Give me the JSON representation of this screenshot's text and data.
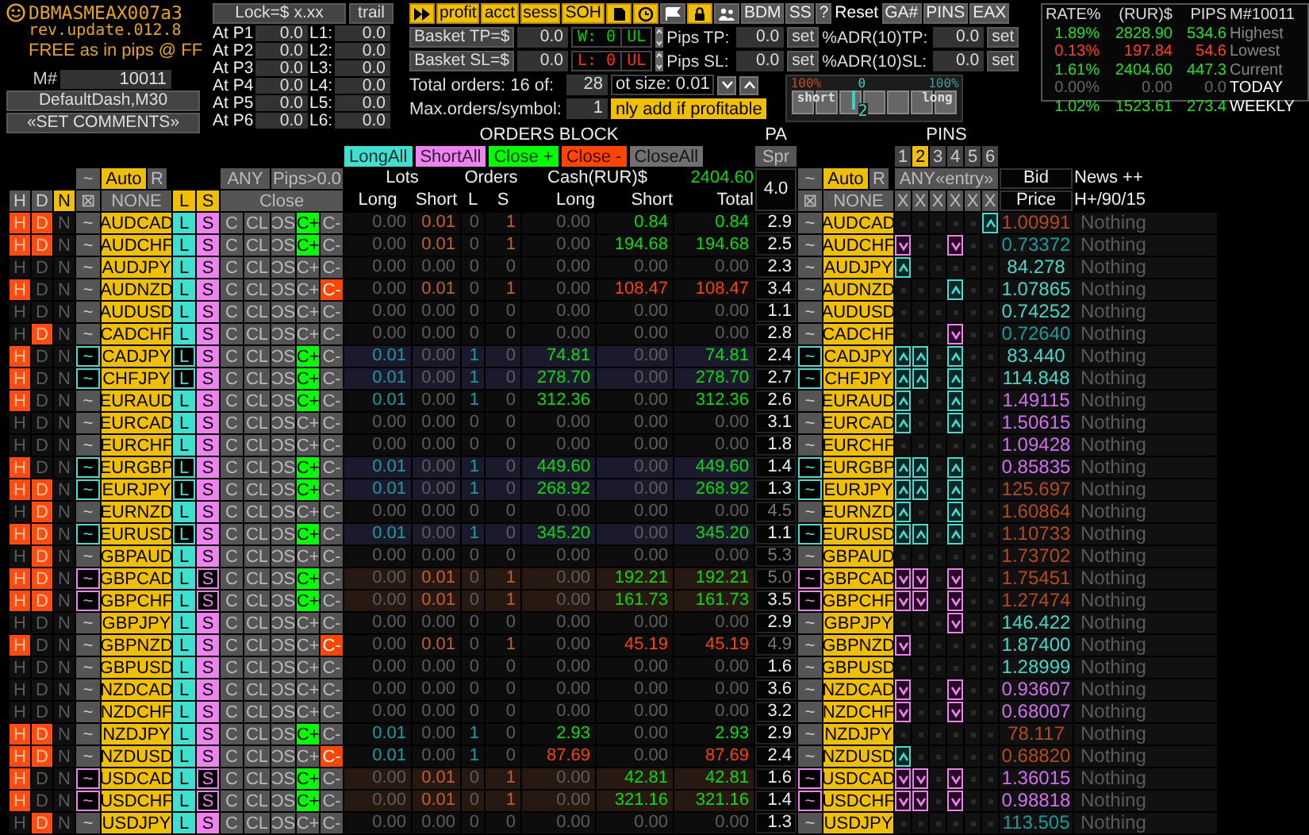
{
  "header": {
    "title": "DBMASMEAX007a3",
    "version": "rev.update.012.8",
    "tagline": "FREE as in pips @ FF",
    "magic_label": "M#",
    "magic": "10011",
    "buttons": [
      "DefaultDash,M30",
      "«SET COMMENTS»"
    ]
  },
  "lock": {
    "title": "Lock=$ x.xx",
    "trail": "trail",
    "rows": [
      {
        "p_label": "At P1",
        "p_value": "0.0",
        "l_label": "L1:",
        "l_value": "0.0"
      },
      {
        "p_label": "At P2",
        "p_value": "0.0",
        "l_label": "L2:",
        "l_value": "0.0"
      },
      {
        "p_label": "At P3",
        "p_value": "0.0",
        "l_label": "L3:",
        "l_value": "0.0"
      },
      {
        "p_label": "At P4",
        "p_value": "0.0",
        "l_label": "L4:",
        "l_value": "0.0"
      },
      {
        "p_label": "At P5",
        "p_value": "0.0",
        "l_label": "L5:",
        "l_value": "0.0"
      },
      {
        "p_label": "At P6",
        "p_value": "0.0",
        "l_label": "L6:",
        "l_value": "0.0"
      }
    ]
  },
  "toolbar": [
    {
      "kind": "icon",
      "active": true
    },
    {
      "kind": "text",
      "label": "profit",
      "active": true
    },
    {
      "kind": "text",
      "label": "acct",
      "active": true
    },
    {
      "kind": "text",
      "label": "sess",
      "active": true
    },
    {
      "kind": "text",
      "label": "SOH",
      "active": true
    },
    {
      "kind": "icon",
      "active": true
    },
    {
      "kind": "icon",
      "active": true
    },
    {
      "kind": "icon",
      "active": false
    },
    {
      "kind": "icon",
      "active": true
    },
    {
      "kind": "icon",
      "active": false
    },
    {
      "kind": "text",
      "label": "BDM",
      "active": false
    },
    {
      "kind": "text",
      "label": "SS",
      "active": false
    },
    {
      "kind": "text",
      "label": "?",
      "active": false
    },
    {
      "kind": "plain",
      "label": "Reset"
    },
    {
      "kind": "text",
      "label": "GA#",
      "active": false
    },
    {
      "kind": "text",
      "label": "PINS",
      "active": false
    },
    {
      "kind": "text",
      "label": "EAX",
      "active": false
    }
  ],
  "basket": [
    {
      "label": "Basket TP=$",
      "value": "0.0",
      "counter": "W: 0",
      "loss": false,
      "ul": "UL",
      "pips_label": "Pips TP:",
      "pips_value": "0.0",
      "pips_set": "set",
      "adr_label": "%ADR(10)TP:",
      "adr_value": "0.0",
      "adr_set": "set"
    },
    {
      "label": "Basket SL=$",
      "value": "0.0",
      "counter": "L: 0",
      "loss": true,
      "ul": "UL",
      "pips_label": "Pips SL:",
      "pips_value": "0.0",
      "pips_set": "set",
      "adr_label": "%ADR(10)SL:",
      "adr_value": "0.0",
      "adr_set": "set"
    }
  ],
  "orders": {
    "total_label": "Total orders: 16 of:",
    "total_value": "28",
    "lot_label": "ot size: 0.01",
    "max_label": "Max.orders/symbol:",
    "max_value": "1",
    "only_add": "nly add if profitable",
    "only_add_on": true
  },
  "balance": {
    "left_pct": "100%",
    "center": "0",
    "right_pct": "100%",
    "short": "short",
    "long": "long",
    "value": "2",
    "level": 0.36
  },
  "stats": {
    "columns": [
      "RATE%",
      "(RUR)$",
      "PIPS",
      "M#10011"
    ],
    "rows": [
      {
        "rate": "1.89%",
        "cash": "2828.90",
        "pips": "534.6",
        "label": "Highest",
        "loss": false,
        "zero": false,
        "label_bright": false
      },
      {
        "rate": "0.13%",
        "cash": "197.84",
        "pips": "54.6",
        "label": "Lowest",
        "loss": true,
        "zero": false,
        "label_bright": false
      },
      {
        "rate": "1.61%",
        "cash": "2404.60",
        "pips": "447.3",
        "label": "Current",
        "loss": false,
        "zero": false,
        "label_bright": false
      },
      {
        "rate": "0.00%",
        "cash": "0.00",
        "pips": "0.0",
        "label": "TODAY",
        "loss": false,
        "zero": true,
        "label_bright": true
      },
      {
        "rate": "1.02%",
        "cash": "1523.61",
        "pips": "273.4",
        "label": "WEEKLY",
        "loss": false,
        "zero": false,
        "label_bright": true
      }
    ]
  },
  "grid_header": {
    "left": {
      "tilde": "~",
      "auto": "Auto",
      "auto_on": true,
      "r": "R",
      "any": "ANY",
      "pips": "Pips>0.0",
      "h": "H",
      "d": "D",
      "n": "N",
      "n_on": true,
      "box": "⊠",
      "none": "NONE",
      "l": "L",
      "s": "S",
      "close": "Close"
    },
    "orders_block": {
      "title": "ORDERS BLOCK",
      "actions": [
        {
          "label": "LongAll",
          "color": "#40e0d0"
        },
        {
          "label": "ShortAll",
          "color": "#ee82ee"
        },
        {
          "label": "Close +",
          "color": "#00ff00"
        },
        {
          "label": "Close -",
          "color": "#ff4500"
        },
        {
          "label": "CloseAll",
          "color": "#707070"
        }
      ],
      "lots": "Lots",
      "orders": "Orders",
      "cash": "Cash(RUR)$",
      "total_cash": "2404.60",
      "sub": [
        "Long",
        "Short",
        "L",
        "S",
        "Long",
        "Short",
        "Total"
      ]
    },
    "pa": {
      "title": "PA",
      "spr": "Spr",
      "value": "4.0"
    },
    "right": {
      "tilde": "~",
      "auto": "Auto",
      "auto_on": true,
      "r": "R",
      "box": "⊠",
      "none": "NONE"
    },
    "pins": {
      "title": "PINS",
      "tabs": [
        {
          "label": "1",
          "selected": false
        },
        {
          "label": "2",
          "selected": true
        },
        {
          "label": "3",
          "selected": false
        },
        {
          "label": "4",
          "selected": false
        },
        {
          "label": "5",
          "selected": false
        },
        {
          "label": "6",
          "selected": false
        }
      ],
      "any": "ANY«entry»",
      "clear": [
        "X",
        "X",
        "X",
        "X",
        "X",
        "X"
      ]
    },
    "bid": {
      "title": "Bid",
      "sub": "Price"
    },
    "news": {
      "title": "News ++",
      "sub": "H+/90/15"
    }
  },
  "rows": [
    {
      "labels": [
        "H",
        "D",
        "N",
        "~",
        "L",
        "S",
        "C",
        "CL",
        "ƆS",
        "C+",
        "C-",
        "~"
      ],
      "h": true,
      "d": true,
      "n": false,
      "symbol": "AUDCAD",
      "long": false,
      "short": true,
      "focus": false,
      "cplus": true,
      "cminus": false,
      "lots_long": "0.00",
      "lots_short": "0.01",
      "orders_long": "0",
      "orders_short": "1",
      "cash_long": "0.00",
      "cash_short": "0.84",
      "cash_total": "0.84",
      "loss": false,
      "spread": "2.9",
      "spread_wide": false,
      "pin_symbol": "AUDCAD",
      "pins": [
        {
          "up": false,
          "down": false
        },
        {
          "up": false,
          "down": false
        },
        {
          "up": false,
          "down": false
        },
        {
          "up": false,
          "down": false
        },
        {
          "up": false,
          "down": false
        },
        {
          "up": true,
          "down": false
        }
      ],
      "bid": "1.00991",
      "color": "#b44a1e",
      "news": "Nothing"
    },
    {
      "labels": [
        "H",
        "D",
        "N",
        "~",
        "L",
        "S",
        "C",
        "CL",
        "ƆS",
        "C+",
        "C-",
        "~"
      ],
      "h": true,
      "d": true,
      "n": false,
      "symbol": "AUDCHF",
      "long": false,
      "short": true,
      "focus": false,
      "cplus": true,
      "cminus": false,
      "lots_long": "0.00",
      "lots_short": "0.01",
      "orders_long": "0",
      "orders_short": "1",
      "cash_long": "0.00",
      "cash_short": "194.68",
      "cash_total": "194.68",
      "loss": false,
      "spread": "2.5",
      "spread_wide": false,
      "pin_symbol": "AUDCHF",
      "pins": [
        {
          "up": false,
          "down": true
        },
        {
          "up": false,
          "down": false
        },
        {
          "up": false,
          "down": false
        },
        {
          "up": false,
          "down": true
        },
        {
          "up": false,
          "down": false
        },
        {
          "up": false,
          "down": false
        }
      ],
      "bid": "0.73372",
      "color": "#1a9a9a",
      "news": "Nothing"
    },
    {
      "labels": [
        "H",
        "D",
        "N",
        "~",
        "L",
        "S",
        "C",
        "CL",
        "ƆS",
        "C+",
        "C-",
        "~"
      ],
      "h": false,
      "d": false,
      "n": false,
      "symbol": "AUDJPY",
      "long": false,
      "short": false,
      "focus": false,
      "cplus": false,
      "cminus": false,
      "lots_long": "0.00",
      "lots_short": "0.00",
      "orders_long": "0",
      "orders_short": "0",
      "cash_long": "0.00",
      "cash_short": "0.00",
      "cash_total": "0.00",
      "loss": false,
      "spread": "2.3",
      "spread_wide": false,
      "pin_symbol": "AUDJPY",
      "pins": [
        {
          "up": true,
          "down": false
        },
        {
          "up": false,
          "down": false
        },
        {
          "up": false,
          "down": false
        },
        {
          "up": false,
          "down": false
        },
        {
          "up": false,
          "down": false
        },
        {
          "up": false,
          "down": false
        }
      ],
      "bid": "84.278",
      "color": "#40d8c8",
      "news": "Nothing"
    },
    {
      "labels": [
        "H",
        "D",
        "N",
        "~",
        "L",
        "S",
        "C",
        "CL",
        "ƆS",
        "C+",
        "C-",
        "~"
      ],
      "h": true,
      "d": false,
      "n": false,
      "symbol": "AUDNZD",
      "long": false,
      "short": true,
      "focus": false,
      "cplus": false,
      "cminus": true,
      "lots_long": "0.00",
      "lots_short": "0.01",
      "orders_long": "0",
      "orders_short": "1",
      "cash_long": "0.00",
      "cash_short": "108.47",
      "cash_total": "108.47",
      "loss": true,
      "spread": "3.4",
      "spread_wide": false,
      "pin_symbol": "AUDNZD",
      "pins": [
        {
          "up": false,
          "down": false
        },
        {
          "up": false,
          "down": false
        },
        {
          "up": false,
          "down": false
        },
        {
          "up": true,
          "down": false
        },
        {
          "up": false,
          "down": false
        },
        {
          "up": false,
          "down": false
        }
      ],
      "bid": "1.07865",
      "color": "#40d8c8",
      "news": "Nothing"
    },
    {
      "labels": [
        "H",
        "D",
        "N",
        "~",
        "L",
        "S",
        "C",
        "CL",
        "ƆS",
        "C+",
        "C-",
        "~"
      ],
      "h": false,
      "d": false,
      "n": false,
      "symbol": "AUDUSD",
      "long": false,
      "short": false,
      "focus": false,
      "cplus": false,
      "cminus": false,
      "lots_long": "0.00",
      "lots_short": "0.00",
      "orders_long": "0",
      "orders_short": "0",
      "cash_long": "0.00",
      "cash_short": "0.00",
      "cash_total": "0.00",
      "loss": false,
      "spread": "1.1",
      "spread_wide": false,
      "pin_symbol": "AUDUSD",
      "pins": [
        {
          "up": false,
          "down": false
        },
        {
          "up": false,
          "down": false
        },
        {
          "up": false,
          "down": false
        },
        {
          "up": false,
          "down": false
        },
        {
          "up": false,
          "down": false
        },
        {
          "up": false,
          "down": false
        }
      ],
      "bid": "0.74252",
      "color": "#40d8c8",
      "news": "Nothing"
    },
    {
      "labels": [
        "H",
        "D",
        "N",
        "~",
        "L",
        "S",
        "C",
        "CL",
        "ƆS",
        "C+",
        "C-",
        "~"
      ],
      "h": false,
      "d": true,
      "n": false,
      "symbol": "CADCHF",
      "long": false,
      "short": false,
      "focus": false,
      "cplus": false,
      "cminus": false,
      "lots_long": "0.00",
      "lots_short": "0.00",
      "orders_long": "0",
      "orders_short": "0",
      "cash_long": "0.00",
      "cash_short": "0.00",
      "cash_total": "0.00",
      "loss": false,
      "spread": "2.8",
      "spread_wide": false,
      "pin_symbol": "CADCHF",
      "pins": [
        {
          "up": false,
          "down": false
        },
        {
          "up": false,
          "down": false
        },
        {
          "up": false,
          "down": false
        },
        {
          "up": false,
          "down": true
        },
        {
          "up": false,
          "down": false
        },
        {
          "up": false,
          "down": false
        }
      ],
      "bid": "0.72640",
      "color": "#1a9a9a",
      "news": "Nothing"
    },
    {
      "labels": [
        "H",
        "D",
        "N",
        "~",
        "L",
        "S",
        "C",
        "CL",
        "ƆS",
        "C+",
        "C-",
        "~"
      ],
      "h": true,
      "d": false,
      "n": false,
      "symbol": "CADJPY",
      "long": true,
      "short": false,
      "focus": true,
      "cplus": true,
      "cminus": false,
      "lots_long": "0.01",
      "lots_short": "0.00",
      "orders_long": "1",
      "orders_short": "0",
      "cash_long": "74.81",
      "cash_short": "0.00",
      "cash_total": "74.81",
      "loss": false,
      "spread": "2.4",
      "spread_wide": false,
      "pin_symbol": "CADJPY",
      "pins": [
        {
          "up": true,
          "down": false
        },
        {
          "up": true,
          "down": false
        },
        {
          "up": false,
          "down": false
        },
        {
          "up": true,
          "down": false
        },
        {
          "up": false,
          "down": false
        },
        {
          "up": false,
          "down": false
        }
      ],
      "bid": "83.440",
      "color": "#40d8c8",
      "news": "Nothing"
    },
    {
      "labels": [
        "H",
        "D",
        "N",
        "~",
        "L",
        "S",
        "C",
        "CL",
        "ƆS",
        "C+",
        "C-",
        "~"
      ],
      "h": true,
      "d": false,
      "n": false,
      "symbol": "CHFJPY",
      "long": true,
      "short": false,
      "focus": true,
      "cplus": true,
      "cminus": false,
      "lots_long": "0.01",
      "lots_short": "0.00",
      "orders_long": "1",
      "orders_short": "0",
      "cash_long": "278.70",
      "cash_short": "0.00",
      "cash_total": "278.70",
      "loss": false,
      "spread": "2.7",
      "spread_wide": false,
      "pin_symbol": "CHFJPY",
      "pins": [
        {
          "up": true,
          "down": false
        },
        {
          "up": true,
          "down": false
        },
        {
          "up": false,
          "down": false
        },
        {
          "up": true,
          "down": false
        },
        {
          "up": false,
          "down": false
        },
        {
          "up": false,
          "down": false
        }
      ],
      "bid": "114.848",
      "color": "#40d8c8",
      "news": "Nothing"
    },
    {
      "labels": [
        "H",
        "D",
        "N",
        "~",
        "L",
        "S",
        "C",
        "CL",
        "ƆS",
        "C+",
        "C-",
        "~"
      ],
      "h": true,
      "d": false,
      "n": false,
      "symbol": "EURAUD",
      "long": true,
      "short": false,
      "focus": false,
      "cplus": true,
      "cminus": false,
      "lots_long": "0.01",
      "lots_short": "0.00",
      "orders_long": "1",
      "orders_short": "0",
      "cash_long": "312.36",
      "cash_short": "0.00",
      "cash_total": "312.36",
      "loss": false,
      "spread": "2.6",
      "spread_wide": false,
      "pin_symbol": "EURAUD",
      "pins": [
        {
          "up": true,
          "down": false
        },
        {
          "up": false,
          "down": false
        },
        {
          "up": false,
          "down": false
        },
        {
          "up": true,
          "down": false
        },
        {
          "up": false,
          "down": false
        },
        {
          "up": false,
          "down": false
        }
      ],
      "bid": "1.49115",
      "color": "#d070f0",
      "news": "Nothing"
    },
    {
      "labels": [
        "H",
        "D",
        "N",
        "~",
        "L",
        "S",
        "C",
        "CL",
        "ƆS",
        "C+",
        "C-",
        "~"
      ],
      "h": false,
      "d": false,
      "n": false,
      "symbol": "EURCAD",
      "long": false,
      "short": false,
      "focus": false,
      "cplus": false,
      "cminus": false,
      "lots_long": "0.00",
      "lots_short": "0.00",
      "orders_long": "0",
      "orders_short": "0",
      "cash_long": "0.00",
      "cash_short": "0.00",
      "cash_total": "0.00",
      "loss": false,
      "spread": "3.1",
      "spread_wide": false,
      "pin_symbol": "EURCAD",
      "pins": [
        {
          "up": true,
          "down": false
        },
        {
          "up": false,
          "down": false
        },
        {
          "up": false,
          "down": false
        },
        {
          "up": true,
          "down": false
        },
        {
          "up": false,
          "down": false
        },
        {
          "up": false,
          "down": false
        }
      ],
      "bid": "1.50615",
      "color": "#d070f0",
      "news": "Nothing"
    },
    {
      "labels": [
        "H",
        "D",
        "N",
        "~",
        "L",
        "S",
        "C",
        "CL",
        "ƆS",
        "C+",
        "C-",
        "~"
      ],
      "h": false,
      "d": false,
      "n": false,
      "symbol": "EURCHF",
      "long": false,
      "short": false,
      "focus": false,
      "cplus": false,
      "cminus": false,
      "lots_long": "0.00",
      "lots_short": "0.00",
      "orders_long": "0",
      "orders_short": "0",
      "cash_long": "0.00",
      "cash_short": "0.00",
      "cash_total": "0.00",
      "loss": false,
      "spread": "1.8",
      "spread_wide": false,
      "pin_symbol": "EURCHF",
      "pins": [
        {
          "up": false,
          "down": false
        },
        {
          "up": false,
          "down": false
        },
        {
          "up": false,
          "down": false
        },
        {
          "up": false,
          "down": false
        },
        {
          "up": false,
          "down": false
        },
        {
          "up": false,
          "down": false
        }
      ],
      "bid": "1.09428",
      "color": "#d070f0",
      "news": "Nothing"
    },
    {
      "labels": [
        "H",
        "D",
        "N",
        "~",
        "L",
        "S",
        "C",
        "CL",
        "ƆS",
        "C+",
        "C-",
        "~"
      ],
      "h": true,
      "d": false,
      "n": false,
      "symbol": "EURGBP",
      "long": true,
      "short": false,
      "focus": true,
      "cplus": true,
      "cminus": false,
      "lots_long": "0.01",
      "lots_short": "0.00",
      "orders_long": "1",
      "orders_short": "0",
      "cash_long": "449.60",
      "cash_short": "0.00",
      "cash_total": "449.60",
      "loss": false,
      "spread": "1.4",
      "spread_wide": false,
      "pin_symbol": "EURGBP",
      "pins": [
        {
          "up": true,
          "down": false
        },
        {
          "up": true,
          "down": false
        },
        {
          "up": false,
          "down": false
        },
        {
          "up": true,
          "down": false
        },
        {
          "up": false,
          "down": false
        },
        {
          "up": false,
          "down": false
        }
      ],
      "bid": "0.85835",
      "color": "#d070f0",
      "news": "Nothing"
    },
    {
      "labels": [
        "H",
        "D",
        "N",
        "~",
        "L",
        "S",
        "C",
        "CL",
        "ƆS",
        "C+",
        "C-",
        "~"
      ],
      "h": true,
      "d": true,
      "n": false,
      "symbol": "EURJPY",
      "long": true,
      "short": false,
      "focus": true,
      "cplus": true,
      "cminus": false,
      "lots_long": "0.01",
      "lots_short": "0.00",
      "orders_long": "1",
      "orders_short": "0",
      "cash_long": "268.92",
      "cash_short": "0.00",
      "cash_total": "268.92",
      "loss": false,
      "spread": "1.3",
      "spread_wide": false,
      "pin_symbol": "EURJPY",
      "pins": [
        {
          "up": true,
          "down": false
        },
        {
          "up": true,
          "down": false
        },
        {
          "up": false,
          "down": false
        },
        {
          "up": true,
          "down": false
        },
        {
          "up": false,
          "down": false
        },
        {
          "up": false,
          "down": false
        }
      ],
      "bid": "125.697",
      "color": "#b44a1e",
      "news": "Nothing"
    },
    {
      "labels": [
        "H",
        "D",
        "N",
        "~",
        "L",
        "S",
        "C",
        "CL",
        "ƆS",
        "C+",
        "C-",
        "~"
      ],
      "h": false,
      "d": true,
      "n": false,
      "symbol": "EURNZD",
      "long": false,
      "short": false,
      "focus": false,
      "cplus": false,
      "cminus": false,
      "lots_long": "0.00",
      "lots_short": "0.00",
      "orders_long": "0",
      "orders_short": "0",
      "cash_long": "0.00",
      "cash_short": "0.00",
      "cash_total": "0.00",
      "loss": false,
      "spread": "4.5",
      "spread_wide": true,
      "pin_symbol": "EURNZD",
      "pins": [
        {
          "up": true,
          "down": false
        },
        {
          "up": false,
          "down": false
        },
        {
          "up": false,
          "down": false
        },
        {
          "up": true,
          "down": false
        },
        {
          "up": false,
          "down": false
        },
        {
          "up": false,
          "down": false
        }
      ],
      "bid": "1.60864",
      "color": "#b44a1e",
      "news": "Nothing"
    },
    {
      "labels": [
        "H",
        "D",
        "N",
        "~",
        "L",
        "S",
        "C",
        "CL",
        "ƆS",
        "C+",
        "C-",
        "~"
      ],
      "h": true,
      "d": true,
      "n": false,
      "symbol": "EURUSD",
      "long": true,
      "short": false,
      "focus": true,
      "cplus": true,
      "cminus": false,
      "lots_long": "0.01",
      "lots_short": "0.00",
      "orders_long": "1",
      "orders_short": "0",
      "cash_long": "345.20",
      "cash_short": "0.00",
      "cash_total": "345.20",
      "loss": false,
      "spread": "1.1",
      "spread_wide": false,
      "pin_symbol": "EURUSD",
      "pins": [
        {
          "up": true,
          "down": false
        },
        {
          "up": true,
          "down": false
        },
        {
          "up": false,
          "down": false
        },
        {
          "up": true,
          "down": false
        },
        {
          "up": false,
          "down": false
        },
        {
          "up": false,
          "down": false
        }
      ],
      "bid": "1.10733",
      "color": "#b44a1e",
      "news": "Nothing"
    },
    {
      "labels": [
        "H",
        "D",
        "N",
        "~",
        "L",
        "S",
        "C",
        "CL",
        "ƆS",
        "C+",
        "C-",
        "~"
      ],
      "h": false,
      "d": true,
      "n": false,
      "symbol": "GBPAUD",
      "long": false,
      "short": false,
      "focus": false,
      "cplus": false,
      "cminus": false,
      "lots_long": "0.00",
      "lots_short": "0.00",
      "orders_long": "0",
      "orders_short": "0",
      "cash_long": "0.00",
      "cash_short": "0.00",
      "cash_total": "0.00",
      "loss": false,
      "spread": "5.3",
      "spread_wide": true,
      "pin_symbol": "GBPAUD",
      "pins": [
        {
          "up": false,
          "down": false
        },
        {
          "up": false,
          "down": false
        },
        {
          "up": false,
          "down": false
        },
        {
          "up": false,
          "down": false
        },
        {
          "up": false,
          "down": false
        },
        {
          "up": false,
          "down": false
        }
      ],
      "bid": "1.73702",
      "color": "#b44a1e",
      "news": "Nothing"
    },
    {
      "labels": [
        "H",
        "D",
        "N",
        "~",
        "L",
        "S",
        "C",
        "CL",
        "ƆS",
        "C+",
        "C-",
        "~"
      ],
      "h": true,
      "d": true,
      "n": false,
      "symbol": "GBPCAD",
      "long": false,
      "short": true,
      "focus": true,
      "cplus": true,
      "cminus": false,
      "lots_long": "0.00",
      "lots_short": "0.01",
      "orders_long": "0",
      "orders_short": "1",
      "cash_long": "0.00",
      "cash_short": "192.21",
      "cash_total": "192.21",
      "loss": false,
      "spread": "5.0",
      "spread_wide": true,
      "pin_symbol": "GBPCAD",
      "pins": [
        {
          "up": false,
          "down": true
        },
        {
          "up": false,
          "down": true
        },
        {
          "up": false,
          "down": false
        },
        {
          "up": false,
          "down": true
        },
        {
          "up": false,
          "down": false
        },
        {
          "up": false,
          "down": false
        }
      ],
      "bid": "1.75451",
      "color": "#b44a1e",
      "news": "Nothing"
    },
    {
      "labels": [
        "H",
        "D",
        "N",
        "~",
        "L",
        "S",
        "C",
        "CL",
        "ƆS",
        "C+",
        "C-",
        "~"
      ],
      "h": true,
      "d": true,
      "n": false,
      "symbol": "GBPCHF",
      "long": false,
      "short": true,
      "focus": true,
      "cplus": true,
      "cminus": false,
      "lots_long": "0.00",
      "lots_short": "0.01",
      "orders_long": "0",
      "orders_short": "1",
      "cash_long": "0.00",
      "cash_short": "161.73",
      "cash_total": "161.73",
      "loss": false,
      "spread": "3.5",
      "spread_wide": false,
      "pin_symbol": "GBPCHF",
      "pins": [
        {
          "up": false,
          "down": true
        },
        {
          "up": false,
          "down": true
        },
        {
          "up": false,
          "down": false
        },
        {
          "up": false,
          "down": true
        },
        {
          "up": false,
          "down": false
        },
        {
          "up": false,
          "down": false
        }
      ],
      "bid": "1.27474",
      "color": "#b44a1e",
      "news": "Nothing"
    },
    {
      "labels": [
        "H",
        "D",
        "N",
        "~",
        "L",
        "S",
        "C",
        "CL",
        "ƆS",
        "C+",
        "C-",
        "~"
      ],
      "h": false,
      "d": false,
      "n": false,
      "symbol": "GBPJPY",
      "long": false,
      "short": false,
      "focus": false,
      "cplus": false,
      "cminus": false,
      "lots_long": "0.00",
      "lots_short": "0.00",
      "orders_long": "0",
      "orders_short": "0",
      "cash_long": "0.00",
      "cash_short": "0.00",
      "cash_total": "0.00",
      "loss": false,
      "spread": "2.9",
      "spread_wide": false,
      "pin_symbol": "GBPJPY",
      "pins": [
        {
          "up": false,
          "down": false
        },
        {
          "up": false,
          "down": false
        },
        {
          "up": false,
          "down": false
        },
        {
          "up": false,
          "down": true
        },
        {
          "up": false,
          "down": false
        },
        {
          "up": false,
          "down": false
        }
      ],
      "bid": "146.422",
      "color": "#40d8c8",
      "news": "Nothing"
    },
    {
      "labels": [
        "H",
        "D",
        "N",
        "~",
        "L",
        "S",
        "C",
        "CL",
        "ƆS",
        "C+",
        "C-",
        "~"
      ],
      "h": true,
      "d": false,
      "n": false,
      "symbol": "GBPNZD",
      "long": false,
      "short": true,
      "focus": false,
      "cplus": false,
      "cminus": true,
      "lots_long": "0.00",
      "lots_short": "0.01",
      "orders_long": "0",
      "orders_short": "1",
      "cash_long": "0.00",
      "cash_short": "45.19",
      "cash_total": "45.19",
      "loss": true,
      "spread": "4.9",
      "spread_wide": true,
      "pin_symbol": "GBPNZD",
      "pins": [
        {
          "up": false,
          "down": true
        },
        {
          "up": false,
          "down": false
        },
        {
          "up": false,
          "down": false
        },
        {
          "up": false,
          "down": false
        },
        {
          "up": false,
          "down": false
        },
        {
          "up": false,
          "down": false
        }
      ],
      "bid": "1.87400",
      "color": "#40d8c8",
      "news": "Nothing"
    },
    {
      "labels": [
        "H",
        "D",
        "N",
        "~",
        "L",
        "S",
        "C",
        "CL",
        "ƆS",
        "C+",
        "C-",
        "~"
      ],
      "h": false,
      "d": false,
      "n": false,
      "symbol": "GBPUSD",
      "long": false,
      "short": false,
      "focus": false,
      "cplus": false,
      "cminus": false,
      "lots_long": "0.00",
      "lots_short": "0.00",
      "orders_long": "0",
      "orders_short": "0",
      "cash_long": "0.00",
      "cash_short": "0.00",
      "cash_total": "0.00",
      "loss": false,
      "spread": "1.6",
      "spread_wide": false,
      "pin_symbol": "GBPUSD",
      "pins": [
        {
          "up": false,
          "down": false
        },
        {
          "up": false,
          "down": false
        },
        {
          "up": false,
          "down": false
        },
        {
          "up": false,
          "down": false
        },
        {
          "up": false,
          "down": false
        },
        {
          "up": false,
          "down": false
        }
      ],
      "bid": "1.28999",
      "color": "#40d8c8",
      "news": "Nothing"
    },
    {
      "labels": [
        "H",
        "D",
        "N",
        "~",
        "L",
        "S",
        "C",
        "CL",
        "ƆS",
        "C+",
        "C-",
        "~"
      ],
      "h": false,
      "d": false,
      "n": false,
      "symbol": "NZDCAD",
      "long": false,
      "short": false,
      "focus": false,
      "cplus": false,
      "cminus": false,
      "lots_long": "0.00",
      "lots_short": "0.00",
      "orders_long": "0",
      "orders_short": "0",
      "cash_long": "0.00",
      "cash_short": "0.00",
      "cash_total": "0.00",
      "loss": false,
      "spread": "3.6",
      "spread_wide": false,
      "pin_symbol": "NZDCAD",
      "pins": [
        {
          "up": false,
          "down": true
        },
        {
          "up": false,
          "down": false
        },
        {
          "up": false,
          "down": false
        },
        {
          "up": false,
          "down": true
        },
        {
          "up": false,
          "down": false
        },
        {
          "up": false,
          "down": false
        }
      ],
      "bid": "0.93607",
      "color": "#d070f0",
      "news": "Nothing"
    },
    {
      "labels": [
        "H",
        "D",
        "N",
        "~",
        "L",
        "S",
        "C",
        "CL",
        "ƆS",
        "C+",
        "C-",
        "~"
      ],
      "h": false,
      "d": false,
      "n": false,
      "symbol": "NZDCHF",
      "long": false,
      "short": false,
      "focus": false,
      "cplus": false,
      "cminus": false,
      "lots_long": "0.00",
      "lots_short": "0.00",
      "orders_long": "0",
      "orders_short": "0",
      "cash_long": "0.00",
      "cash_short": "0.00",
      "cash_total": "0.00",
      "loss": false,
      "spread": "3.2",
      "spread_wide": false,
      "pin_symbol": "NZDCHF",
      "pins": [
        {
          "up": false,
          "down": true
        },
        {
          "up": false,
          "down": false
        },
        {
          "up": false,
          "down": false
        },
        {
          "up": false,
          "down": true
        },
        {
          "up": false,
          "down": false
        },
        {
          "up": false,
          "down": false
        }
      ],
      "bid": "0.68007",
      "color": "#d070f0",
      "news": "Nothing"
    },
    {
      "labels": [
        "H",
        "D",
        "N",
        "~",
        "L",
        "S",
        "C",
        "CL",
        "ƆS",
        "C+",
        "C-",
        "~"
      ],
      "h": true,
      "d": true,
      "n": false,
      "symbol": "NZDJPY",
      "long": true,
      "short": false,
      "focus": false,
      "cplus": true,
      "cminus": false,
      "lots_long": "0.01",
      "lots_short": "0.00",
      "orders_long": "1",
      "orders_short": "0",
      "cash_long": "2.93",
      "cash_short": "0.00",
      "cash_total": "2.93",
      "loss": false,
      "spread": "2.9",
      "spread_wide": false,
      "pin_symbol": "NZDJPY",
      "pins": [
        {
          "up": false,
          "down": false
        },
        {
          "up": false,
          "down": false
        },
        {
          "up": false,
          "down": false
        },
        {
          "up": false,
          "down": false
        },
        {
          "up": false,
          "down": false
        },
        {
          "up": false,
          "down": false
        }
      ],
      "bid": "78.117",
      "color": "#b44a1e",
      "news": "Nothing"
    },
    {
      "labels": [
        "H",
        "D",
        "N",
        "~",
        "L",
        "S",
        "C",
        "CL",
        "ƆS",
        "C+",
        "C-",
        "~"
      ],
      "h": true,
      "d": true,
      "n": false,
      "symbol": "NZDUSD",
      "long": true,
      "short": false,
      "focus": false,
      "cplus": false,
      "cminus": true,
      "lots_long": "0.01",
      "lots_short": "0.00",
      "orders_long": "1",
      "orders_short": "0",
      "cash_long": "87.69",
      "cash_short": "0.00",
      "cash_total": "87.69",
      "loss": true,
      "spread": "2.4",
      "spread_wide": false,
      "pin_symbol": "NZDUSD",
      "pins": [
        {
          "up": true,
          "down": false
        },
        {
          "up": false,
          "down": false
        },
        {
          "up": false,
          "down": false
        },
        {
          "up": false,
          "down": false
        },
        {
          "up": false,
          "down": false
        },
        {
          "up": false,
          "down": false
        }
      ],
      "bid": "0.68820",
      "color": "#b44a1e",
      "news": "Nothing"
    },
    {
      "labels": [
        "H",
        "D",
        "N",
        "~",
        "L",
        "S",
        "C",
        "CL",
        "ƆS",
        "C+",
        "C-",
        "~"
      ],
      "h": true,
      "d": false,
      "n": false,
      "symbol": "USDCAD",
      "long": false,
      "short": true,
      "focus": true,
      "cplus": true,
      "cminus": false,
      "lots_long": "0.00",
      "lots_short": "0.01",
      "orders_long": "0",
      "orders_short": "1",
      "cash_long": "0.00",
      "cash_short": "42.81",
      "cash_total": "42.81",
      "loss": false,
      "spread": "1.6",
      "spread_wide": false,
      "pin_symbol": "USDCAD",
      "pins": [
        {
          "up": false,
          "down": true
        },
        {
          "up": false,
          "down": true
        },
        {
          "up": false,
          "down": false
        },
        {
          "up": false,
          "down": true
        },
        {
          "up": false,
          "down": false
        },
        {
          "up": false,
          "down": false
        }
      ],
      "bid": "1.36015",
      "color": "#d070f0",
      "news": "Nothing"
    },
    {
      "labels": [
        "H",
        "D",
        "N",
        "~",
        "L",
        "S",
        "C",
        "CL",
        "ƆS",
        "C+",
        "C-",
        "~"
      ],
      "h": true,
      "d": false,
      "n": false,
      "symbol": "USDCHF",
      "long": false,
      "short": true,
      "focus": true,
      "cplus": true,
      "cminus": false,
      "lots_long": "0.00",
      "lots_short": "0.01",
      "orders_long": "0",
      "orders_short": "1",
      "cash_long": "0.00",
      "cash_short": "321.16",
      "cash_total": "321.16",
      "loss": false,
      "spread": "1.4",
      "spread_wide": false,
      "pin_symbol": "USDCHF",
      "pins": [
        {
          "up": false,
          "down": true
        },
        {
          "up": false,
          "down": true
        },
        {
          "up": false,
          "down": false
        },
        {
          "up": false,
          "down": true
        },
        {
          "up": false,
          "down": false
        },
        {
          "up": false,
          "down": false
        }
      ],
      "bid": "0.98818",
      "color": "#d070f0",
      "news": "Nothing"
    },
    {
      "labels": [
        "H",
        "D",
        "N",
        "~",
        "L",
        "S",
        "C",
        "CL",
        "ƆS",
        "C+",
        "C-",
        "~"
      ],
      "h": false,
      "d": true,
      "n": false,
      "symbol": "USDJPY",
      "long": false,
      "short": false,
      "focus": false,
      "cplus": false,
      "cminus": false,
      "lots_long": "0.00",
      "lots_short": "0.00",
      "orders_long": "0",
      "orders_short": "0",
      "cash_long": "0.00",
      "cash_short": "0.00",
      "cash_total": "0.00",
      "loss": false,
      "spread": "1.3",
      "spread_wide": false,
      "pin_symbol": "USDJPY",
      "pins": [
        {
          "up": false,
          "down": false
        },
        {
          "up": false,
          "down": false
        },
        {
          "up": false,
          "down": false
        },
        {
          "up": false,
          "down": false
        },
        {
          "up": false,
          "down": false
        },
        {
          "up": false,
          "down": false
        }
      ],
      "bid": "113.505",
      "color": "#1a9a9a",
      "news": "Nothing"
    }
  ]
}
